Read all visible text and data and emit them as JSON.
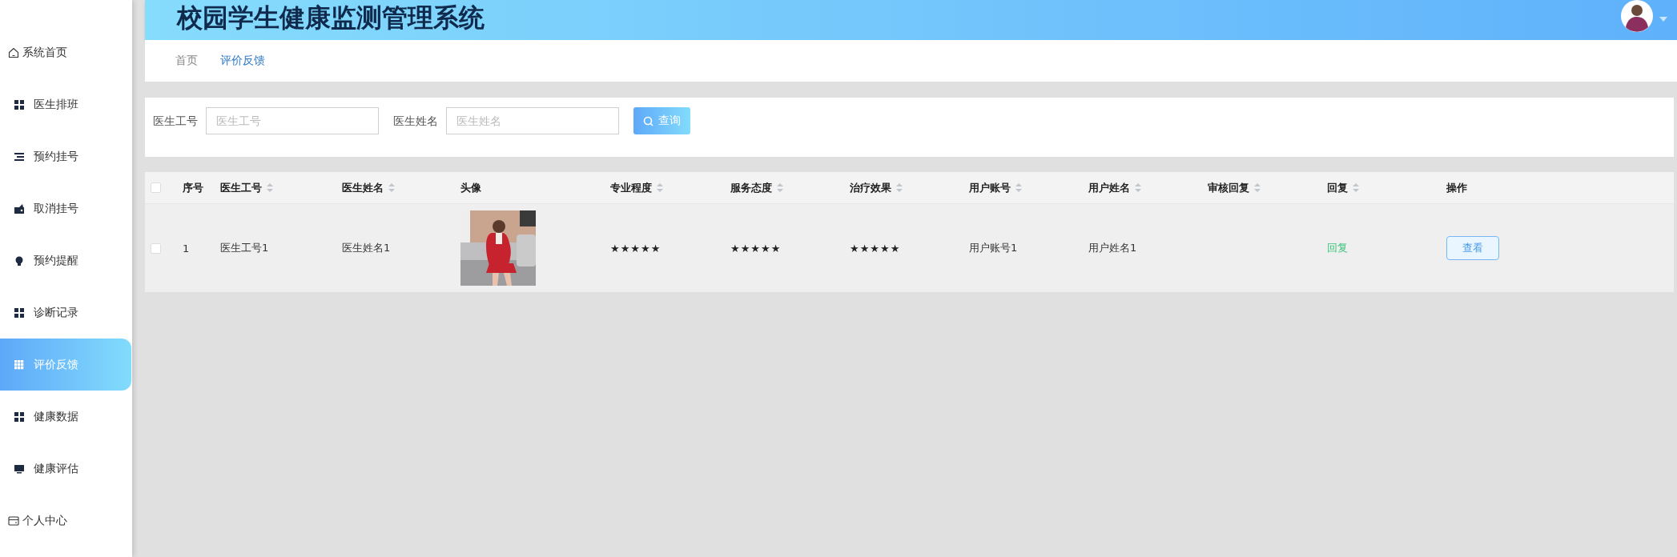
{
  "header": {
    "title": "校园学生健康监测管理系统"
  },
  "sidebar": {
    "items": [
      {
        "label": "系统首页",
        "kind": "link",
        "selected": false
      },
      {
        "label": "医生排班",
        "kind": "menu",
        "selected": false
      },
      {
        "label": "预约挂号",
        "kind": "menu",
        "selected": false
      },
      {
        "label": "取消挂号",
        "kind": "menu",
        "selected": false
      },
      {
        "label": "预约提醒",
        "kind": "menu",
        "selected": false
      },
      {
        "label": "诊断记录",
        "kind": "menu",
        "selected": false
      },
      {
        "label": "评价反馈",
        "kind": "menu",
        "selected": true
      },
      {
        "label": "健康数据",
        "kind": "menu",
        "selected": false
      },
      {
        "label": "健康评估",
        "kind": "menu",
        "selected": false
      },
      {
        "label": "个人中心",
        "kind": "link",
        "selected": false
      }
    ]
  },
  "breadcrumb": [
    {
      "label": "首页",
      "selected": false
    },
    {
      "label": "评价反馈",
      "selected": true
    }
  ],
  "search": {
    "fields": [
      {
        "label": "医生工号",
        "placeholder": "医生工号"
      },
      {
        "label": "医生姓名",
        "placeholder": "医生姓名"
      }
    ],
    "button": "查询"
  },
  "table": {
    "header_checked": false,
    "columns": [
      {
        "label": "序号",
        "sortable": false
      },
      {
        "label": "医生工号",
        "sortable": true
      },
      {
        "label": "医生姓名",
        "sortable": true
      },
      {
        "label": "头像",
        "sortable": false
      },
      {
        "label": "专业程度",
        "sortable": true
      },
      {
        "label": "服务态度",
        "sortable": true
      },
      {
        "label": "治疗效果",
        "sortable": true
      },
      {
        "label": "用户账号",
        "sortable": true
      },
      {
        "label": "用户姓名",
        "sortable": true
      },
      {
        "label": "审核回复",
        "sortable": true
      },
      {
        "label": "回复",
        "sortable": true
      },
      {
        "label": "操作",
        "sortable": false
      }
    ],
    "rows": [
      {
        "checked": false,
        "index": "1",
        "doctor_id": "医生工号1",
        "doctor_name": "医生姓名1",
        "professionalism": {
          "stars": 5
        },
        "service": {
          "stars": 5
        },
        "effect": {
          "stars": 5
        },
        "user_account": "用户账号1",
        "user_name": "用户姓名1",
        "reply_link": "回复",
        "action": "查看"
      }
    ]
  }
}
